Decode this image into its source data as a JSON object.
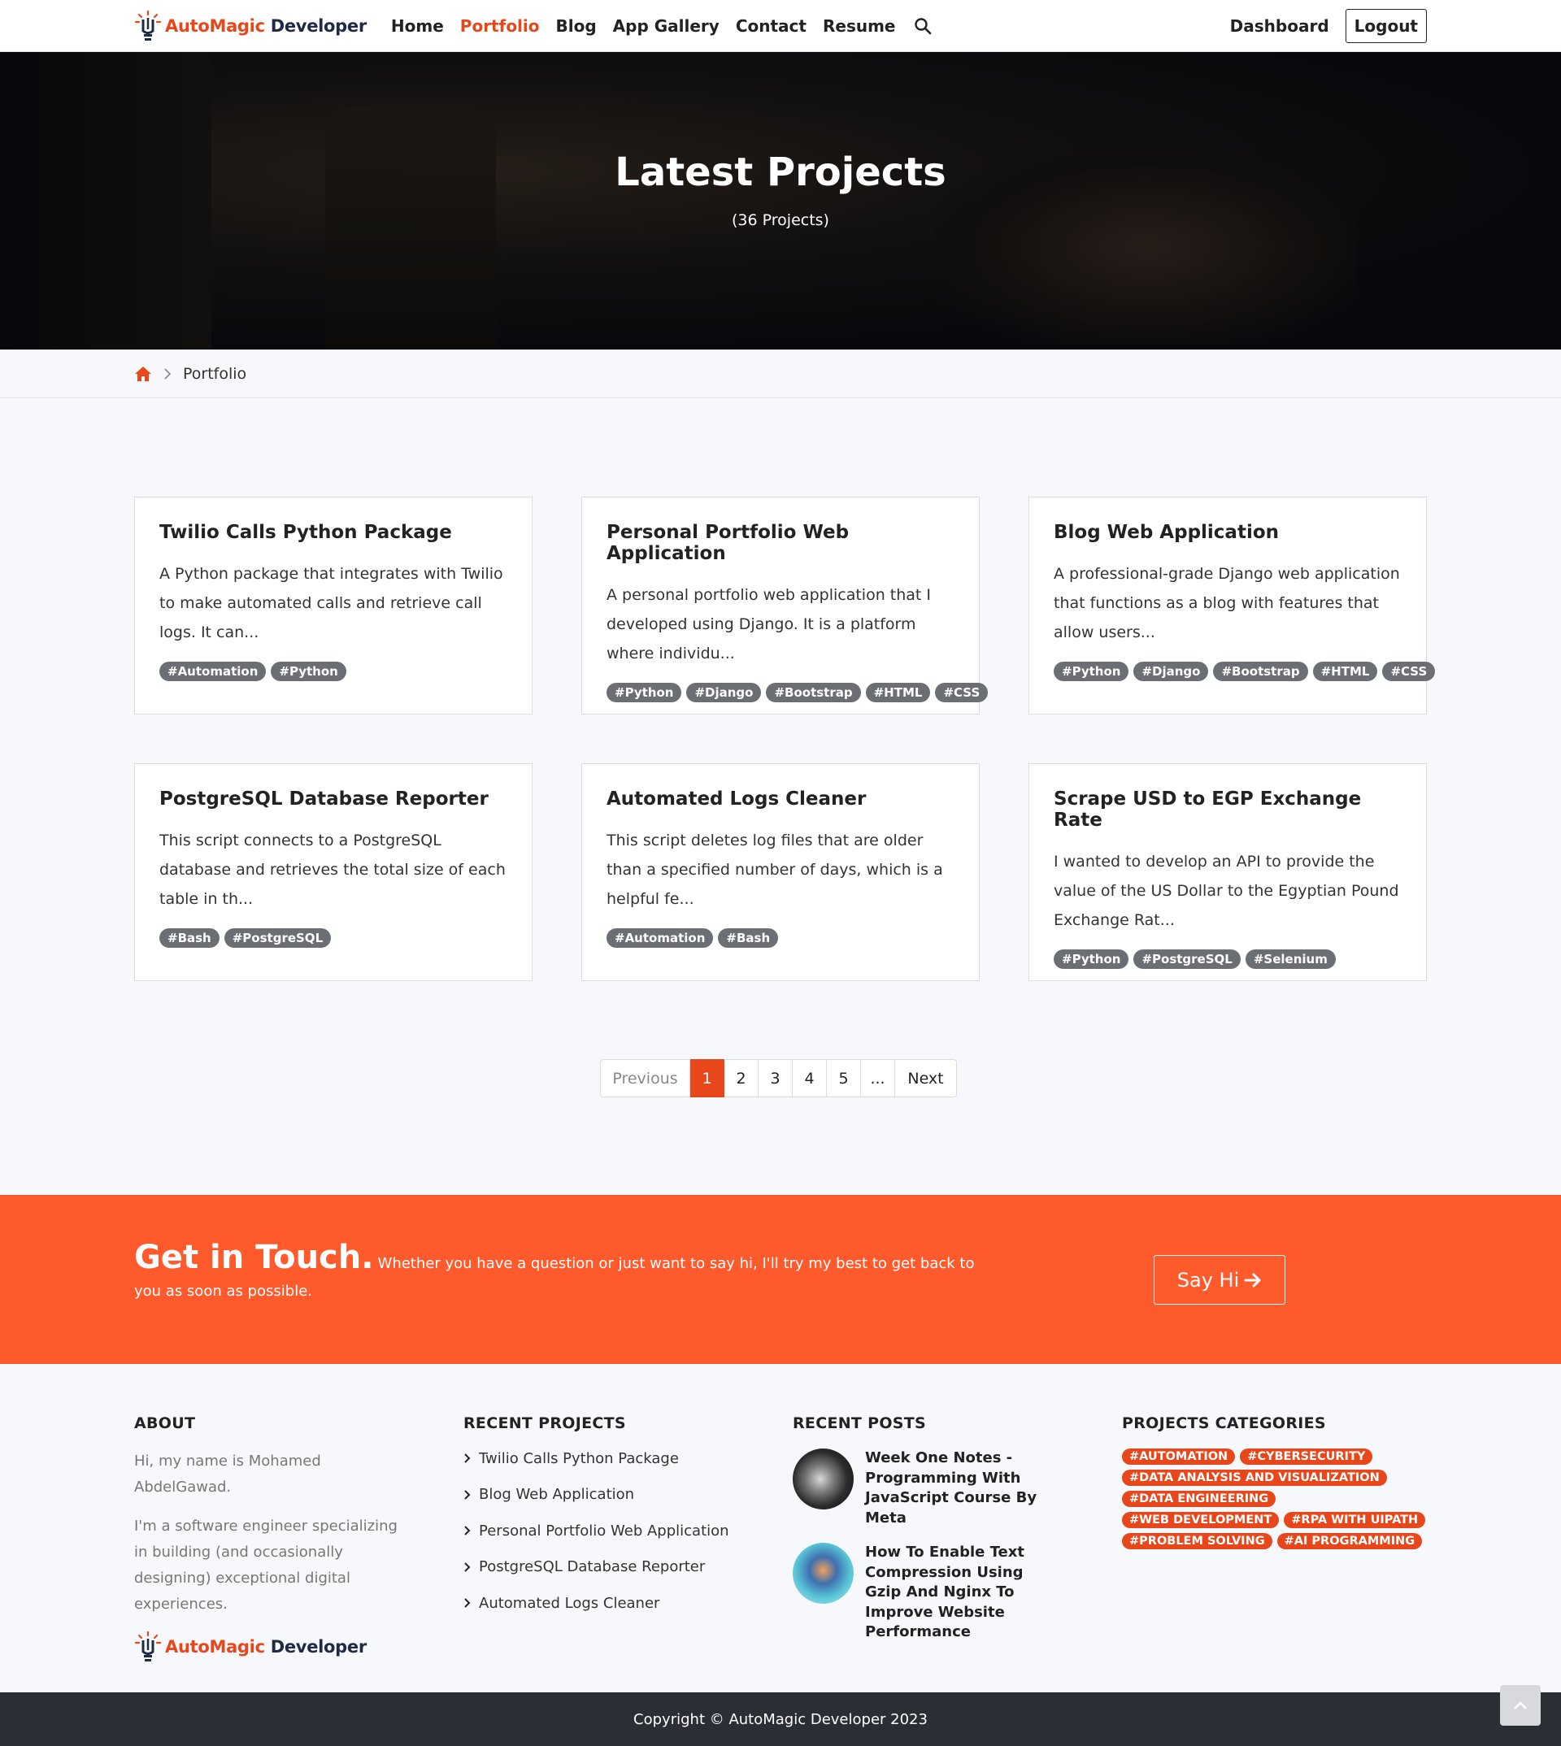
{
  "nav": {
    "logo_part1": "AutoMagic",
    "logo_part2": "Developer",
    "items": [
      "Home",
      "Portfolio",
      "Blog",
      "App Gallery",
      "Contact",
      "Resume"
    ],
    "active_item": "Portfolio",
    "dashboard": "Dashboard",
    "logout": "Logout"
  },
  "hero": {
    "title": "Latest Projects",
    "subtitle": "(36 Projects)"
  },
  "breadcrumb": {
    "current": "Portfolio"
  },
  "projects": [
    {
      "title": "Twilio Calls Python Package",
      "desc": "A Python package that integrates with Twilio to make automated calls and retrieve call logs. It can...",
      "tags": [
        "#Automation",
        "#Python"
      ]
    },
    {
      "title": "Personal Portfolio Web Application",
      "desc": "A personal portfolio web application that I developed using Django. It is a platform where individu...",
      "tags": [
        "#Python",
        "#Django",
        "#Bootstrap",
        "#HTML",
        "#CSS"
      ]
    },
    {
      "title": "Blog Web Application",
      "desc": "A professional-grade Django web application that functions as a blog with features that allow users...",
      "tags": [
        "#Python",
        "#Django",
        "#Bootstrap",
        "#HTML",
        "#CSS"
      ]
    },
    {
      "title": "PostgreSQL Database Reporter",
      "desc": "This script connects to a PostgreSQL database and retrieves the total size of each table in th...",
      "tags": [
        "#Bash",
        "#PostgreSQL"
      ]
    },
    {
      "title": "Automated Logs Cleaner",
      "desc": "This script deletes log files that are older than a specified number of days, which is a helpful fe...",
      "tags": [
        "#Automation",
        "#Bash"
      ]
    },
    {
      "title": "Scrape USD to EGP Exchange Rate",
      "desc": "I wanted to develop an API to provide the value of the US Dollar to the Egyptian Pound Exchange Rat...",
      "tags": [
        "#Python",
        "#PostgreSQL",
        "#Selenium"
      ]
    }
  ],
  "pagination": {
    "previous": "Previous",
    "pages": [
      "1",
      "2",
      "3",
      "4",
      "5",
      "..."
    ],
    "current": "1",
    "next": "Next"
  },
  "cta": {
    "heading": "Get in Touch.",
    "text": "Whether you have a question or just want to say hi, I'll try my best to get back to you as soon as possible.",
    "button": "Say Hi"
  },
  "footer": {
    "about": {
      "heading": "ABOUT",
      "p1": "Hi, my name is Mohamed AbdelGawad.",
      "p2": "I'm a software engineer specializing in building (and occasionally designing) exceptional digital experiences."
    },
    "recent_projects": {
      "heading": "RECENT PROJECTS",
      "items": [
        "Twilio Calls Python Package",
        "Blog Web Application",
        "Personal Portfolio Web Application",
        "PostgreSQL Database Reporter",
        "Automated Logs Cleaner"
      ]
    },
    "recent_posts": {
      "heading": "RECENT POSTS",
      "items": [
        "Week One Notes - Programming With JavaScript Course By Meta",
        "How To Enable Text Compression Using Gzip And Nginx To Improve Website Performance"
      ]
    },
    "categories": {
      "heading": "PROJECTS CATEGORIES",
      "items": [
        "#AUTOMATION",
        "#CYBERSECURITY",
        "#DATA ANALYSIS AND VISUALIZATION",
        "#DATA ENGINEERING",
        "#WEB DEVELOPMENT",
        "#RPA WITH UIPATH",
        "#PROBLEM SOLVING",
        "#AI PROGRAMMING"
      ]
    },
    "copyright": "Copyright © AutoMagic Developer 2023"
  },
  "colors": {
    "accent": "#e8471c",
    "cta_bg": "#ff5a2c",
    "tag_bg": "#6b6e73",
    "footer_bar": "#2b2f35"
  }
}
